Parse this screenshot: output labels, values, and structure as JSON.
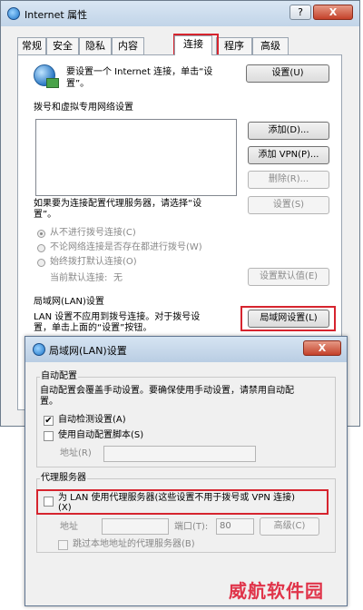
{
  "outer_window": {
    "title": "Internet 属性",
    "help_button": "?",
    "close_button": "X",
    "tabs": [
      {
        "label": "常规"
      },
      {
        "label": "安全"
      },
      {
        "label": "隐私"
      },
      {
        "label": "内容"
      },
      {
        "label": "连接"
      },
      {
        "label": "程序"
      },
      {
        "label": "高级"
      }
    ],
    "active_tab": "连接",
    "setup": {
      "text_line1": "要设置一个 Internet 连接，单击“设",
      "text_line2": "置”。",
      "button": "设置(U)"
    },
    "dialup": {
      "heading": "拨号和虚拟专用网络设置",
      "add_button": "添加(D)...",
      "add_vpn_button": "添加 VPN(P)...",
      "delete_button": "删除(R)...",
      "proxy_note_line1": "如果要为连接配置代理服务器，请选择“设",
      "proxy_note_line2": "置”。",
      "settings_button": "设置(S)",
      "radio_never": "从不进行拨号连接(C)",
      "radio_no_network": "不论网络连接是否存在都进行拨号(W)",
      "radio_always": "始终拨打默认连接(O)",
      "current_default_label": "当前默认连接:",
      "current_default_value": "无",
      "set_default_button": "设置默认值(E)"
    },
    "lan": {
      "heading": "局域网(LAN)设置",
      "text_line1": "LAN 设置不应用到拨号连接。对于拨号设",
      "text_line2": "置，单击上面的“设置”按钮。",
      "button": "局域网设置(L)"
    }
  },
  "lan_dialog": {
    "title": "局域网(LAN)设置",
    "close_button": "X",
    "auto_config": {
      "heading": "自动配置",
      "desc_line1": "自动配置会覆盖手动设置。要确保使用手动设置，请禁用自动配",
      "desc_line2": "置。",
      "auto_detect_label": "自动检测设置(A)",
      "auto_detect_checked": true,
      "use_script_label": "使用自动配置脚本(S)",
      "use_script_checked": false,
      "address_label": "地址(R)",
      "address_value": ""
    },
    "proxy": {
      "heading": "代理服务器",
      "use_proxy_line1": "为 LAN 使用代理服务器(这些设置不用于拨号或 VPN 连接)",
      "use_proxy_line2": "(X)",
      "use_proxy_checked": false,
      "address_label": "地址",
      "address_value": "",
      "port_label": "端口(T):",
      "port_value": "80",
      "advanced_button": "高级(C)",
      "bypass_label": "跳过本地地址的代理服务器(B)",
      "bypass_checked": false
    }
  },
  "watermark": "威航软件园",
  "colors": {
    "highlight_box": "#d6242e",
    "titlebar": "#c1d4e8",
    "watermark": "#e0344a"
  }
}
